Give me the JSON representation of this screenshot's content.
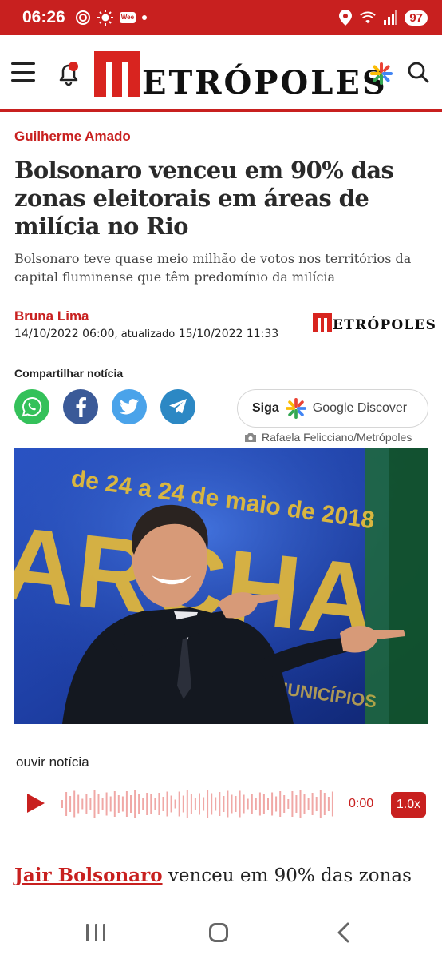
{
  "status_bar": {
    "time": "06:26",
    "battery": "97",
    "news_badge": "Wee",
    "colors": {
      "background": "#c8201f"
    }
  },
  "header": {
    "logo_text": "ETRÓPOLES",
    "icons": [
      "menu-icon",
      "bell-icon",
      "google-discover-icon",
      "search-icon"
    ]
  },
  "article": {
    "kicker": "Guilherme Amado",
    "headline": "Bolsonaro venceu em 90% das zonas eleitorais em áreas de milícia no Rio",
    "subhead": "Bolsonaro teve quase meio milhão de votos nos territórios da capital fluminense que têm predomínio da milícia",
    "author": "Bruna Lima",
    "published": "14/10/2022 06:00",
    "updated_label": "atualizado",
    "updated": "15/10/2022 11:33",
    "source_logo_text": "ETRÓPOLES"
  },
  "share": {
    "label": "Compartilhar notícia",
    "buttons": [
      "whatsapp-icon",
      "facebook-icon",
      "twitter-icon",
      "telegram-icon"
    ],
    "discover_follow": "Siga",
    "discover_label": "Google Discover"
  },
  "photo": {
    "credit": "Rafaela Felicciano/Metrópoles",
    "banner_text_top": "de 24 a 24 de maio de 2018",
    "banner_text_big": "ARCHA",
    "banner_text_bottom": "DOS MUNICÍPIOS"
  },
  "audio": {
    "label": "ouvir notícia",
    "time": "0:00",
    "speed": "1.0x"
  },
  "body": {
    "link_text": "Jair Bolsonaro",
    "text": " venceu em 90% das zonas"
  },
  "colors": {
    "accent": "#c8201f",
    "whatsapp": "#34c15a",
    "facebook": "#3b5a98",
    "twitter": "#4aa3ea",
    "telegram": "#2c88c4"
  }
}
